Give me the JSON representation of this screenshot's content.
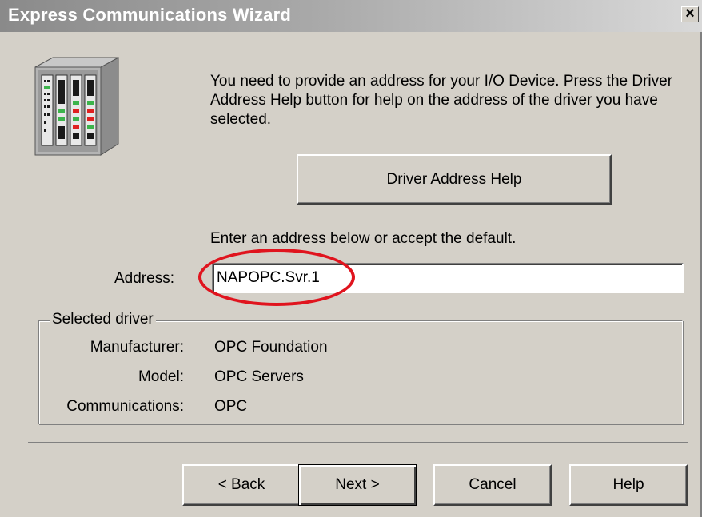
{
  "window": {
    "title": "Express Communications Wizard",
    "close_symbol": "×"
  },
  "icons": {
    "device": "io-device-rack-icon"
  },
  "intro": {
    "text": "You need to provide an address for your I/O Device. Press the Driver Address Help button for help on the address of the driver you have selected."
  },
  "driver_help_button": {
    "label": "Driver Address Help"
  },
  "address": {
    "instruction": "Enter an address below or accept the default.",
    "label": "Address:",
    "value": "NAPOPC.Svr.1"
  },
  "selected_driver": {
    "legend": "Selected driver",
    "manufacturer_label": "Manufacturer:",
    "manufacturer_value": "OPC Foundation",
    "model_label": "Model:",
    "model_value": "OPC Servers",
    "communications_label": "Communications:",
    "communications_value": "OPC"
  },
  "buttons": {
    "back": "< Back",
    "next": "Next >",
    "cancel": "Cancel",
    "help": "Help"
  },
  "colors": {
    "highlight": "#e0141e",
    "dialog_bg": "#d4d0c8"
  }
}
